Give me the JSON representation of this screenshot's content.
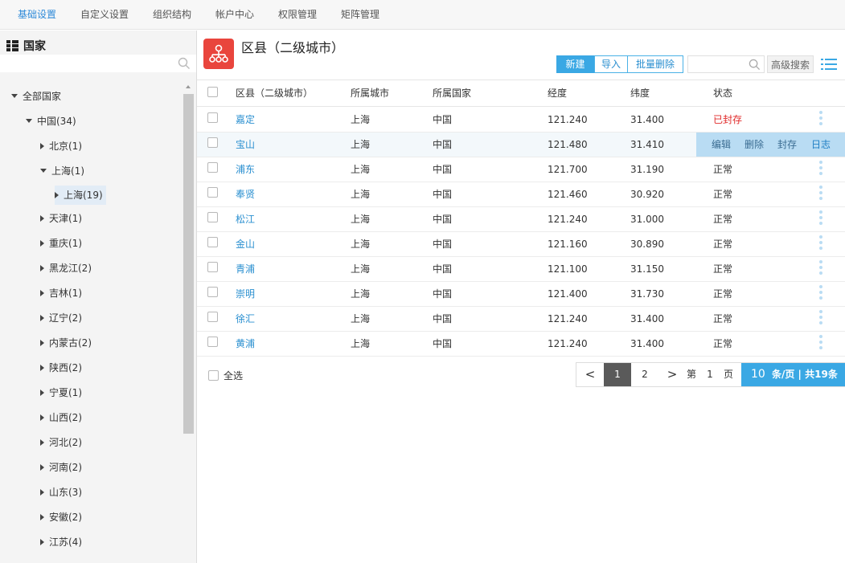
{
  "topnav": {
    "items": [
      "基础设置",
      "自定义设置",
      "组织结构",
      "帐户中心",
      "权限管理",
      "矩阵管理"
    ],
    "active_index": 0
  },
  "sidebar": {
    "title": "国家",
    "search_placeholder": "",
    "tree": {
      "root": "全部国家",
      "country": "中国(34)",
      "provinces": [
        "北京(1)",
        "上海(1)",
        "天津(1)",
        "重庆(1)",
        "黑龙江(2)",
        "吉林(1)",
        "辽宁(2)",
        "内蒙古(2)",
        "陕西(2)",
        "宁夏(1)",
        "山西(2)",
        "河北(2)",
        "河南(2)",
        "山东(3)",
        "安徽(2)",
        "江苏(4)"
      ],
      "expanded_province_index": 1,
      "selected_child": "上海(19)"
    }
  },
  "header": {
    "title": "区县（二级城市）",
    "buttons": {
      "new": "新建",
      "import": "导入",
      "batch_delete": "批量删除"
    },
    "search_value": "",
    "advanced_search": "高级搜索"
  },
  "table": {
    "columns": [
      "区县（二级城市）",
      "所属城市",
      "所属国家",
      "经度",
      "纬度",
      "状态"
    ],
    "rows": [
      {
        "name": "嘉定",
        "city": "上海",
        "country": "中国",
        "lng": "121.240",
        "lat": "31.400",
        "status": "已封存"
      },
      {
        "name": "宝山",
        "city": "上海",
        "country": "中国",
        "lng": "121.480",
        "lat": "31.410",
        "status": ""
      },
      {
        "name": "浦东",
        "city": "上海",
        "country": "中国",
        "lng": "121.700",
        "lat": "31.190",
        "status": "正常"
      },
      {
        "name": "奉贤",
        "city": "上海",
        "country": "中国",
        "lng": "121.460",
        "lat": "30.920",
        "status": "正常"
      },
      {
        "name": "松江",
        "city": "上海",
        "country": "中国",
        "lng": "121.240",
        "lat": "31.000",
        "status": "正常"
      },
      {
        "name": "金山",
        "city": "上海",
        "country": "中国",
        "lng": "121.160",
        "lat": "30.890",
        "status": "正常"
      },
      {
        "name": "青浦",
        "city": "上海",
        "country": "中国",
        "lng": "121.100",
        "lat": "31.150",
        "status": "正常"
      },
      {
        "name": "崇明",
        "city": "上海",
        "country": "中国",
        "lng": "121.400",
        "lat": "31.730",
        "status": "正常"
      },
      {
        "name": "徐汇",
        "city": "上海",
        "country": "中国",
        "lng": "121.240",
        "lat": "31.400",
        "status": "正常"
      },
      {
        "name": "黄浦",
        "city": "上海",
        "country": "中国",
        "lng": "121.240",
        "lat": "31.400",
        "status": "正常"
      }
    ],
    "hover_row_index": 1,
    "row_actions": [
      "编辑",
      "删除",
      "封存",
      "日志"
    ]
  },
  "footer": {
    "select_all": "全选",
    "pager": {
      "prev": "<",
      "pages": [
        "1",
        "2"
      ],
      "current": "1",
      "next": ">",
      "goto_prefix": "第",
      "goto_value": "1",
      "goto_suffix": "页",
      "page_size": "10",
      "summary": "条/页 | 共19条"
    }
  },
  "colors": {
    "accent": "#3aa8e4",
    "link": "#2a8fd0",
    "danger": "#e02a2a",
    "page_icon": "#e9453d"
  }
}
